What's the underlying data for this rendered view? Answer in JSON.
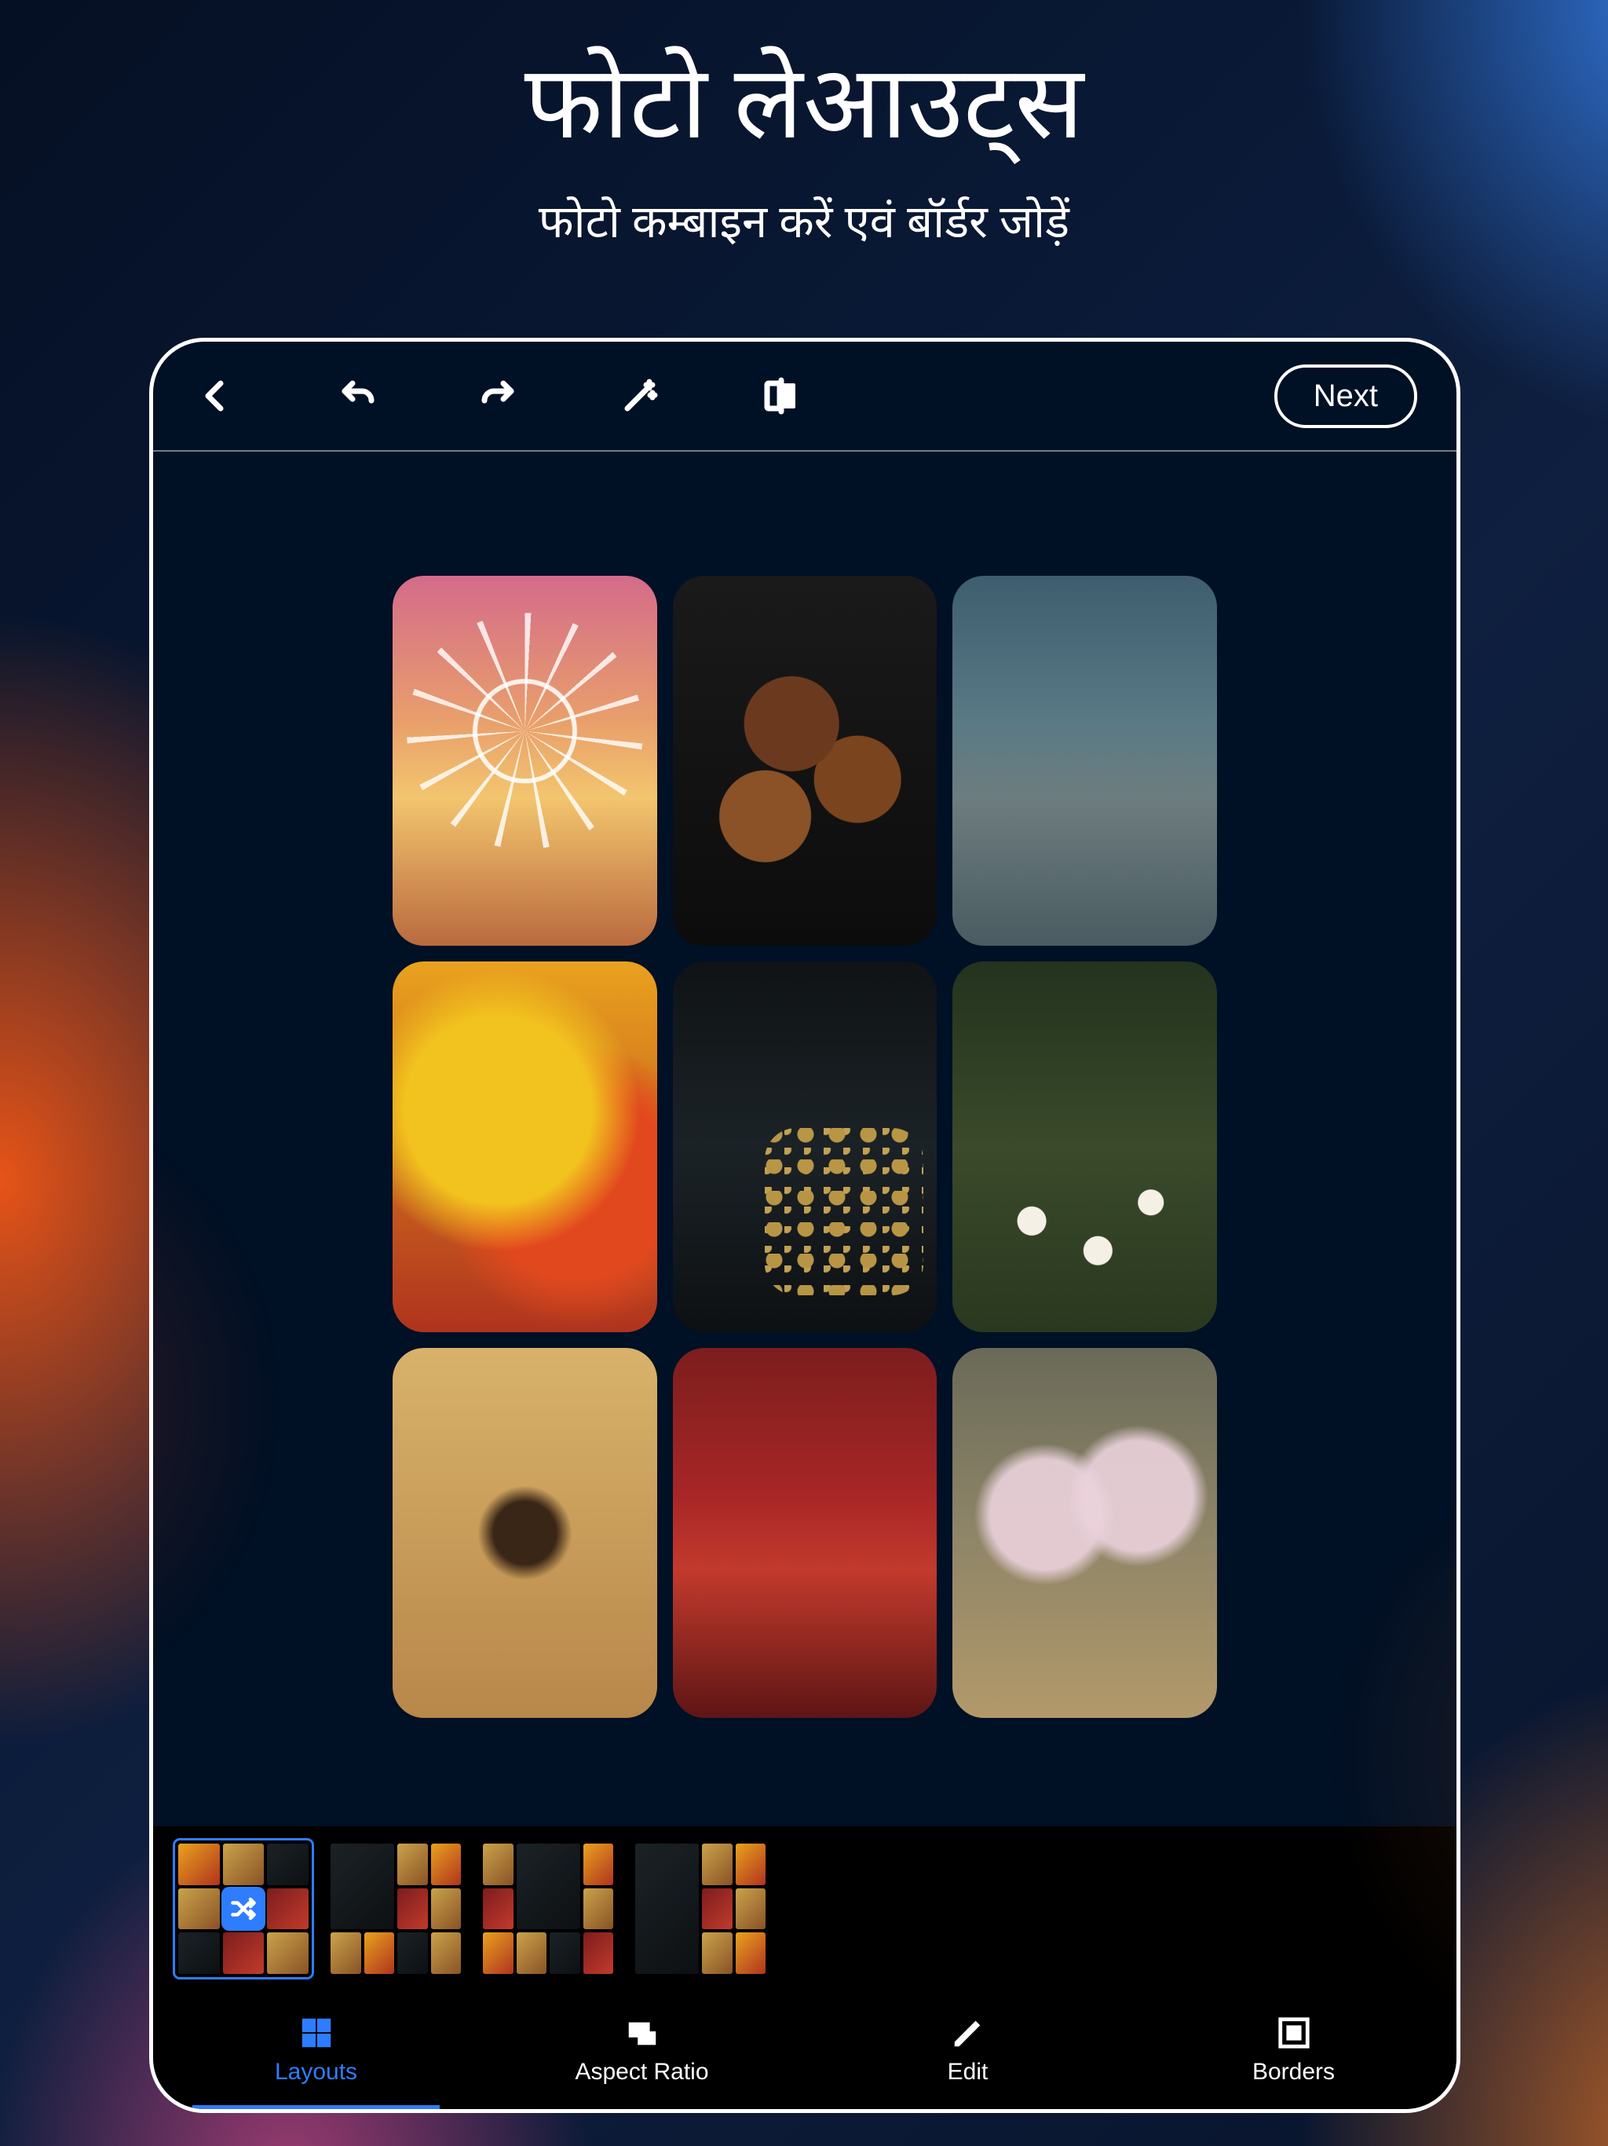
{
  "header": {
    "title": "फोटो लेआउट्स",
    "subtitle": "फोटो कम्बाइन करें एवं बॉर्डर जोड़ें"
  },
  "topbar": {
    "icons": [
      "back-arrow",
      "undo",
      "redo",
      "magic-wand",
      "compare"
    ],
    "next_label": "Next"
  },
  "collage": {
    "tiles": [
      "ferris-wheel",
      "donuts",
      "street-crossing",
      "holi-colors",
      "jewellery",
      "flowers",
      "mehndi-hands",
      "red-corridor",
      "cocktails"
    ]
  },
  "layout_strip": {
    "selected_index": 0,
    "options": [
      "grid-3x3-shuffle",
      "grid-big-left",
      "grid-big-center",
      "grid-big-side"
    ]
  },
  "bottombar": {
    "tabs": [
      {
        "id": "layouts",
        "label": "Layouts",
        "active": true
      },
      {
        "id": "aspect",
        "label": "Aspect Ratio",
        "active": false
      },
      {
        "id": "edit",
        "label": "Edit",
        "active": false
      },
      {
        "id": "borders",
        "label": "Borders",
        "active": false
      }
    ]
  },
  "colors": {
    "accent": "#2e7dff"
  }
}
